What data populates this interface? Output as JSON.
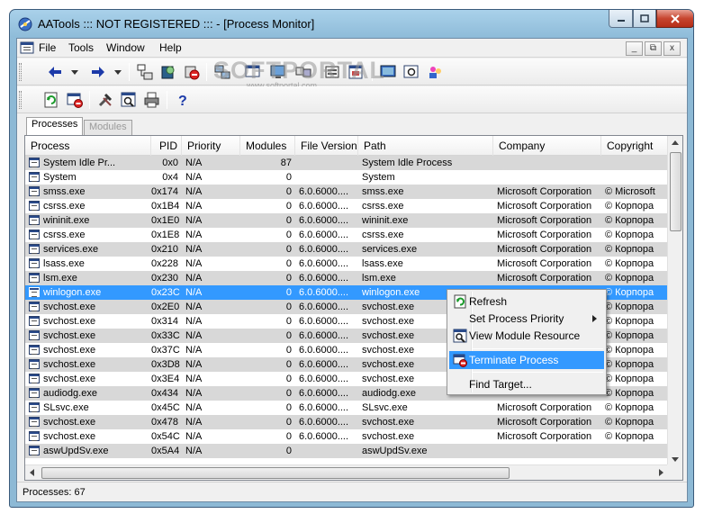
{
  "window": {
    "title": "AATools ::: NOT REGISTERED ::: - [Process Monitor]"
  },
  "menubar": {
    "items": [
      "File",
      "Tools",
      "Window",
      "Help"
    ],
    "mdi_min": "_",
    "mdi_restore": "⧉",
    "mdi_close": "x"
  },
  "watermark": {
    "text": "SOFTPORTAL",
    "sub": "www.softportal.com"
  },
  "tabs": [
    "Processes",
    "Modules"
  ],
  "columns": [
    "Process",
    "PID",
    "Priority",
    "Modules",
    "File Version",
    "Path",
    "Company",
    "Copyright"
  ],
  "rows": [
    {
      "process": "System Idle Pr...",
      "pid": "0x0",
      "priority": "N/A",
      "modules": "87",
      "version": "",
      "path": "System Idle Process",
      "company": "",
      "copyright": ""
    },
    {
      "process": "System",
      "pid": "0x4",
      "priority": "N/A",
      "modules": "0",
      "version": "",
      "path": "System",
      "company": "",
      "copyright": ""
    },
    {
      "process": "smss.exe",
      "pid": "0x174",
      "priority": "N/A",
      "modules": "0",
      "version": "6.0.6000....",
      "path": "smss.exe",
      "company": "Microsoft Corporation",
      "copyright": "© Microsoft"
    },
    {
      "process": "csrss.exe",
      "pid": "0x1B4",
      "priority": "N/A",
      "modules": "0",
      "version": "6.0.6000....",
      "path": "csrss.exe",
      "company": "Microsoft Corporation",
      "copyright": "© Корпора"
    },
    {
      "process": "wininit.exe",
      "pid": "0x1E0",
      "priority": "N/A",
      "modules": "0",
      "version": "6.0.6000....",
      "path": "wininit.exe",
      "company": "Microsoft Corporation",
      "copyright": "© Корпора"
    },
    {
      "process": "csrss.exe",
      "pid": "0x1E8",
      "priority": "N/A",
      "modules": "0",
      "version": "6.0.6000....",
      "path": "csrss.exe",
      "company": "Microsoft Corporation",
      "copyright": "© Корпора"
    },
    {
      "process": "services.exe",
      "pid": "0x210",
      "priority": "N/A",
      "modules": "0",
      "version": "6.0.6000....",
      "path": "services.exe",
      "company": "Microsoft Corporation",
      "copyright": "© Корпора"
    },
    {
      "process": "lsass.exe",
      "pid": "0x228",
      "priority": "N/A",
      "modules": "0",
      "version": "6.0.6000....",
      "path": "lsass.exe",
      "company": "Microsoft Corporation",
      "copyright": "© Корпора"
    },
    {
      "process": "lsm.exe",
      "pid": "0x230",
      "priority": "N/A",
      "modules": "0",
      "version": "6.0.6000....",
      "path": "lsm.exe",
      "company": "Microsoft Corporation",
      "copyright": "© Корпора"
    },
    {
      "process": "winlogon.exe",
      "pid": "0x23C",
      "priority": "N/A",
      "modules": "0",
      "version": "6.0.6000....",
      "path": "winlogon.exe",
      "company": "",
      "copyright": "© Корпора"
    },
    {
      "process": "svchost.exe",
      "pid": "0x2E0",
      "priority": "N/A",
      "modules": "0",
      "version": "6.0.6000....",
      "path": "svchost.exe",
      "company": "",
      "copyright": "© Корпора"
    },
    {
      "process": "svchost.exe",
      "pid": "0x314",
      "priority": "N/A",
      "modules": "0",
      "version": "6.0.6000....",
      "path": "svchost.exe",
      "company": "",
      "copyright": "© Корпора"
    },
    {
      "process": "svchost.exe",
      "pid": "0x33C",
      "priority": "N/A",
      "modules": "0",
      "version": "6.0.6000....",
      "path": "svchost.exe",
      "company": "",
      "copyright": "© Корпора"
    },
    {
      "process": "svchost.exe",
      "pid": "0x37C",
      "priority": "N/A",
      "modules": "0",
      "version": "6.0.6000....",
      "path": "svchost.exe",
      "company": "",
      "copyright": "© Корпора"
    },
    {
      "process": "svchost.exe",
      "pid": "0x3D8",
      "priority": "N/A",
      "modules": "0",
      "version": "6.0.6000....",
      "path": "svchost.exe",
      "company": "",
      "copyright": "© Корпора"
    },
    {
      "process": "svchost.exe",
      "pid": "0x3E4",
      "priority": "N/A",
      "modules": "0",
      "version": "6.0.6000....",
      "path": "svchost.exe",
      "company": "",
      "copyright": "© Корпора"
    },
    {
      "process": "audiodg.exe",
      "pid": "0x434",
      "priority": "N/A",
      "modules": "0",
      "version": "6.0.6000....",
      "path": "audiodg.exe",
      "company": "",
      "copyright": "© Корпора"
    },
    {
      "process": "SLsvc.exe",
      "pid": "0x45C",
      "priority": "N/A",
      "modules": "0",
      "version": "6.0.6000....",
      "path": "SLsvc.exe",
      "company": "Microsoft Corporation",
      "copyright": "© Корпора"
    },
    {
      "process": "svchost.exe",
      "pid": "0x478",
      "priority": "N/A",
      "modules": "0",
      "version": "6.0.6000....",
      "path": "svchost.exe",
      "company": "Microsoft Corporation",
      "copyright": "© Корпора"
    },
    {
      "process": "svchost.exe",
      "pid": "0x54C",
      "priority": "N/A",
      "modules": "0",
      "version": "6.0.6000....",
      "path": "svchost.exe",
      "company": "Microsoft Corporation",
      "copyright": "© Корпора"
    },
    {
      "process": "aswUpdSv.exe",
      "pid": "0x5A4",
      "priority": "N/A",
      "modules": "0",
      "version": "",
      "path": "aswUpdSv.exe",
      "company": "",
      "copyright": ""
    }
  ],
  "selected_row": 9,
  "context_menu": {
    "items": [
      {
        "label": "Refresh",
        "icon": "refresh-icon"
      },
      {
        "label": "Set Process Priority",
        "icon": "",
        "submenu": true
      },
      {
        "label": "View Module Resource",
        "icon": "view-module-icon"
      },
      {
        "label": "Terminate Process",
        "icon": "terminate-icon"
      },
      {
        "label": "Find Target...",
        "icon": ""
      }
    ],
    "highlighted": 3
  },
  "status": {
    "text": "Processes: 67"
  },
  "colors": {
    "selection": "#3399ff",
    "alt_row": "#d8d8d8",
    "window_frame": "#8fbcd9"
  }
}
